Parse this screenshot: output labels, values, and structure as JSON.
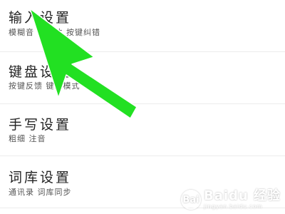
{
  "settings": {
    "items": [
      {
        "title": "输入设置",
        "subtitle": "模糊音 候繁体 按键纠错"
      },
      {
        "title": "键盘设置",
        "subtitle": "按键反馈 键盘模式"
      },
      {
        "title": "手写设置",
        "subtitle": "粗细 注音"
      },
      {
        "title": "词库设置",
        "subtitle": "通讯录 词库同步"
      }
    ]
  },
  "annotation": {
    "arrow_color": "#22e022",
    "icon": "arrow-pointer-icon"
  },
  "watermark": {
    "logo_text": "Bai",
    "text": "Baidu 经验",
    "url": "jingyan.baidu.com"
  }
}
